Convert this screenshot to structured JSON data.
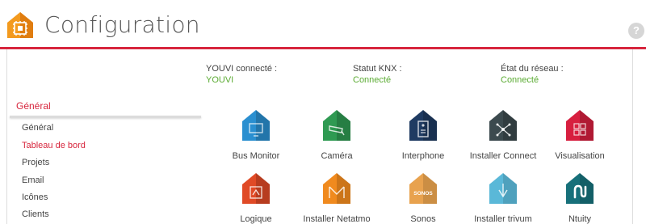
{
  "header": {
    "title": "Configuration",
    "help": "?"
  },
  "status": [
    {
      "label": "YOUVI connecté :",
      "value": "YOUVI"
    },
    {
      "label": "Statut KNX :",
      "value": "Connecté"
    },
    {
      "label": "État du réseau :",
      "value": "Connecté"
    }
  ],
  "sidebar": {
    "heading": "Général",
    "items": [
      {
        "label": "Général"
      },
      {
        "label": "Tableau de bord"
      },
      {
        "label": "Projets"
      },
      {
        "label": "Email"
      },
      {
        "label": "Icônes"
      },
      {
        "label": "Clients"
      }
    ]
  },
  "modules": [
    {
      "label": "Bus Monitor",
      "color": "#2a8fd0",
      "icon": "monitor-icon"
    },
    {
      "label": "Caméra",
      "color": "#2f9a52",
      "icon": "camera-icon"
    },
    {
      "label": "Interphone",
      "color": "#1f3b62",
      "icon": "intercom-icon"
    },
    {
      "label": "Installer Connect",
      "color": "#3c4a4e",
      "icon": "network-icon"
    },
    {
      "label": "Visualisation",
      "color": "#d71f3f",
      "icon": "grid-icon"
    },
    {
      "label": "Logique",
      "color": "#e04a26",
      "icon": "logic-icon"
    },
    {
      "label": "Installer Netatmo",
      "color": "#f08a1e",
      "icon": "netatmo-icon"
    },
    {
      "label": "Sonos",
      "color": "#e8a24e",
      "icon": "sonos-icon",
      "badge": "SONOS"
    },
    {
      "label": "Installer trivum",
      "color": "#5ab8d8",
      "icon": "trivum-icon"
    },
    {
      "label": "Ntuity",
      "color": "#17707a",
      "icon": "ntuity-icon"
    }
  ]
}
